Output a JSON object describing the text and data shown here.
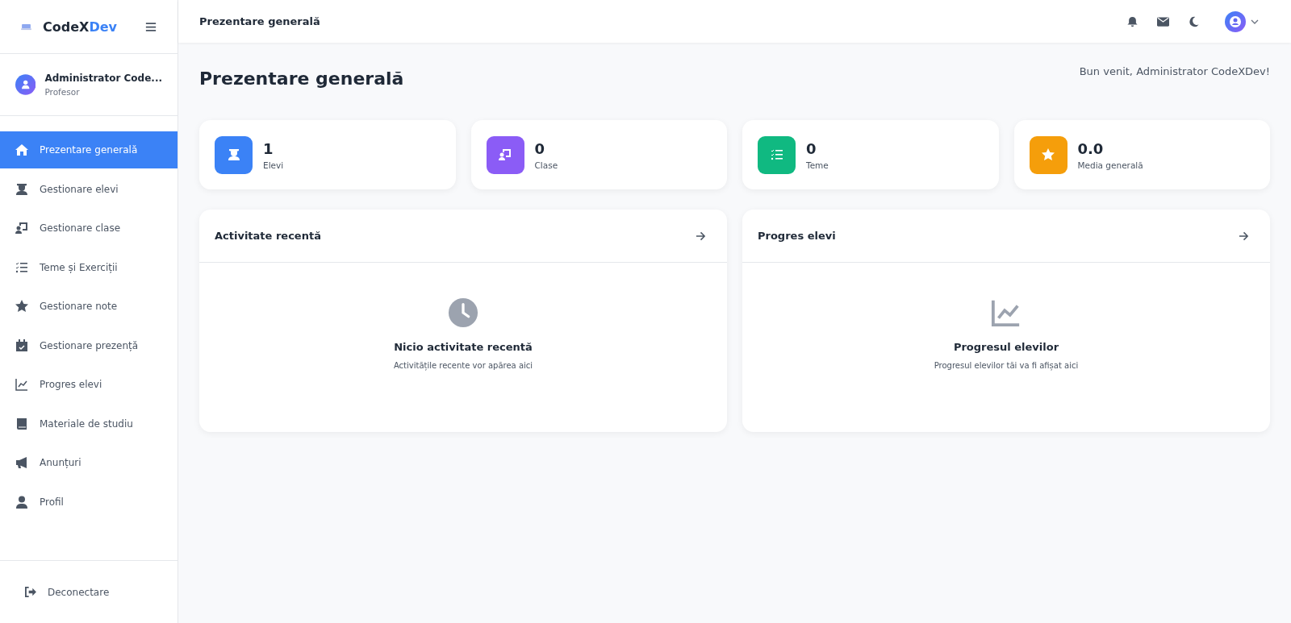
{
  "sidebar": {
    "logo": {
      "part1": "CodeX",
      "part2": "Dev"
    },
    "user": {
      "name": "Administrator Code...",
      "role": "Profesor"
    },
    "items": [
      {
        "label": "Prezentare generală",
        "selected": true
      },
      {
        "label": "Gestionare elevi",
        "selected": false
      },
      {
        "label": "Gestionare clase",
        "selected": false
      },
      {
        "label": "Teme și Exerciții",
        "selected": false
      },
      {
        "label": "Gestionare note",
        "selected": false
      },
      {
        "label": "Gestionare prezență",
        "selected": false
      },
      {
        "label": "Progres elevi",
        "selected": false
      },
      {
        "label": "Materiale de studiu",
        "selected": false
      },
      {
        "label": "Anunțuri",
        "selected": false
      },
      {
        "label": "Profil",
        "selected": false
      }
    ],
    "logout": "Deconectare"
  },
  "topbar": {
    "title": "Prezentare generală"
  },
  "page": {
    "title": "Prezentare generală",
    "welcome": "Bun venit, Administrator CodeXDev!"
  },
  "stats": [
    {
      "value": "1",
      "label": "Elevi",
      "color": "#3b82f6"
    },
    {
      "value": "0",
      "label": "Clase",
      "color": "#8b5cf6"
    },
    {
      "value": "0",
      "label": "Teme",
      "color": "#10b981"
    },
    {
      "value": "0.0",
      "label": "Media generală",
      "color": "#f59e0b"
    }
  ],
  "panels": [
    {
      "title": "Activitate recentă",
      "empty_title": "Nicio activitate recentă",
      "empty_text": "Activitățile recente vor apărea aici"
    },
    {
      "title": "Progres elevi",
      "empty_title": "Progresul elevilor",
      "empty_text": "Progresul elevilor tăi va fi afișat aici"
    }
  ]
}
